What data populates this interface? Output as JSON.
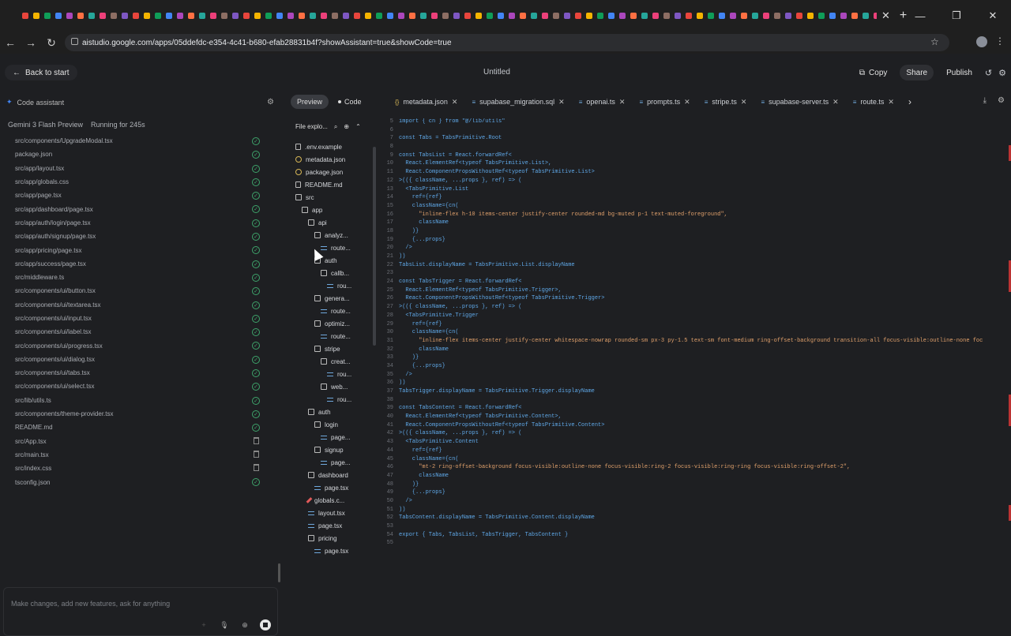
{
  "browser": {
    "tab_close": "✕",
    "new_tab": "+",
    "url": "aistudio.google.com/apps/05ddefdc-e354-4c41-b680-efab28831b4f?showAssistant=true&showCode=true",
    "win_min": "—",
    "win_max": "❐",
    "win_close": "✕"
  },
  "app": {
    "back_label": "Back to start",
    "title": "Untitled",
    "copy_label": "Copy",
    "share_label": "Share",
    "publish_label": "Publish"
  },
  "assistant": {
    "header": "Code assistant",
    "model": "Gemini 3 Flash Preview",
    "running": "Running for 245s",
    "prompt_placeholder": "Make changes, add new features, ask for anything",
    "files": [
      {
        "name": "src/components/UpgradeModal.tsx",
        "state": "done"
      },
      {
        "name": "package.json",
        "state": "done"
      },
      {
        "name": "src/app/layout.tsx",
        "state": "done"
      },
      {
        "name": "src/app/globals.css",
        "state": "done"
      },
      {
        "name": "src/app/page.tsx",
        "state": "done"
      },
      {
        "name": "src/app/dashboard/page.tsx",
        "state": "done"
      },
      {
        "name": "src/app/auth/login/page.tsx",
        "state": "done"
      },
      {
        "name": "src/app/auth/signup/page.tsx",
        "state": "done"
      },
      {
        "name": "src/app/pricing/page.tsx",
        "state": "done"
      },
      {
        "name": "src/app/success/page.tsx",
        "state": "done"
      },
      {
        "name": "src/middleware.ts",
        "state": "done"
      },
      {
        "name": "src/components/ui/button.tsx",
        "state": "done"
      },
      {
        "name": "src/components/ui/textarea.tsx",
        "state": "done"
      },
      {
        "name": "src/components/ui/input.tsx",
        "state": "done"
      },
      {
        "name": "src/components/ui/label.tsx",
        "state": "done"
      },
      {
        "name": "src/components/ui/progress.tsx",
        "state": "done"
      },
      {
        "name": "src/components/ui/dialog.tsx",
        "state": "done"
      },
      {
        "name": "src/components/ui/tabs.tsx",
        "state": "done"
      },
      {
        "name": "src/components/ui/select.tsx",
        "state": "done"
      },
      {
        "name": "src/lib/utils.ts",
        "state": "done"
      },
      {
        "name": "src/components/theme-provider.tsx",
        "state": "done"
      },
      {
        "name": "README.md",
        "state": "done"
      },
      {
        "name": "src/App.tsx",
        "state": "deleted"
      },
      {
        "name": "src/main.tsx",
        "state": "deleted"
      },
      {
        "name": "src/index.css",
        "state": "deleted"
      },
      {
        "name": "tsconfig.json",
        "state": "done"
      }
    ]
  },
  "editor": {
    "preview_label": "Preview",
    "code_label": "Code",
    "file_tabs": [
      "metadata.json",
      "supabase_migration.sql",
      "openai.ts",
      "prompts.ts",
      "stripe.ts",
      "supabase-server.ts",
      "route.ts"
    ],
    "explorer_title": "File explo...",
    "tree": [
      {
        "label": ".env.example",
        "icon": "file",
        "indent": 0
      },
      {
        "label": "metadata.json",
        "icon": "json",
        "indent": 0
      },
      {
        "label": "package.json",
        "icon": "json",
        "indent": 0
      },
      {
        "label": "README.md",
        "icon": "file",
        "indent": 0
      },
      {
        "label": "src",
        "icon": "folder",
        "indent": 0
      },
      {
        "label": "app",
        "icon": "folder",
        "indent": 1
      },
      {
        "label": "api",
        "icon": "folder",
        "indent": 2
      },
      {
        "label": "analyz...",
        "icon": "folder",
        "indent": 3
      },
      {
        "label": "route...",
        "icon": "lines",
        "indent": 4
      },
      {
        "label": "auth",
        "icon": "folder",
        "indent": 3
      },
      {
        "label": "callb...",
        "icon": "folder",
        "indent": 4
      },
      {
        "label": "rou...",
        "icon": "lines",
        "indent": 5
      },
      {
        "label": "genera...",
        "icon": "folder",
        "indent": 3
      },
      {
        "label": "route...",
        "icon": "lines",
        "indent": 4
      },
      {
        "label": "optimiz...",
        "icon": "folder",
        "indent": 3
      },
      {
        "label": "route...",
        "icon": "lines",
        "indent": 4
      },
      {
        "label": "stripe",
        "icon": "folder",
        "indent": 3
      },
      {
        "label": "creat...",
        "icon": "folder",
        "indent": 4
      },
      {
        "label": "rou...",
        "icon": "lines",
        "indent": 5
      },
      {
        "label": "web...",
        "icon": "folder",
        "indent": 4
      },
      {
        "label": "rou...",
        "icon": "lines",
        "indent": 5
      },
      {
        "label": "auth",
        "icon": "folder",
        "indent": 2
      },
      {
        "label": "login",
        "icon": "folder",
        "indent": 3
      },
      {
        "label": "page...",
        "icon": "lines",
        "indent": 4
      },
      {
        "label": "signup",
        "icon": "folder",
        "indent": 3
      },
      {
        "label": "page...",
        "icon": "lines",
        "indent": 4
      },
      {
        "label": "dashboard",
        "icon": "folder",
        "indent": 2
      },
      {
        "label": "page.tsx",
        "icon": "lines",
        "indent": 3
      },
      {
        "label": "globals.c...",
        "icon": "pen",
        "indent": 2
      },
      {
        "label": "layout.tsx",
        "icon": "lines",
        "indent": 2
      },
      {
        "label": "page.tsx",
        "icon": "lines",
        "indent": 2
      },
      {
        "label": "pricing",
        "icon": "folder",
        "indent": 2
      },
      {
        "label": "page.tsx",
        "icon": "lines",
        "indent": 3
      }
    ],
    "code_lines": [
      {
        "n": "5",
        "t": "import { cn } from \"@/lib/utils\""
      },
      {
        "n": "6",
        "t": ""
      },
      {
        "n": "7",
        "t": "const Tabs = TabsPrimitive.Root"
      },
      {
        "n": "8",
        "t": ""
      },
      {
        "n": "9",
        "t": "const TabsList = React.forwardRef<"
      },
      {
        "n": "10",
        "t": "  React.ElementRef<typeof TabsPrimitive.List>,"
      },
      {
        "n": "11",
        "t": "  React.ComponentPropsWithoutRef<typeof TabsPrimitive.List>"
      },
      {
        "n": "12",
        "t": ">(({ className, ...props }, ref) => ("
      },
      {
        "n": "13",
        "t": "  <TabsPrimitive.List"
      },
      {
        "n": "14",
        "t": "    ref={ref}"
      },
      {
        "n": "15",
        "t": "    className={cn("
      },
      {
        "n": "16",
        "t": "      \"inline-flex h-10 items-center justify-center rounded-md bg-muted p-1 text-muted-foreground\","
      },
      {
        "n": "17",
        "t": "      className"
      },
      {
        "n": "18",
        "t": "    )}"
      },
      {
        "n": "19",
        "t": "    {...props}"
      },
      {
        "n": "20",
        "t": "  />"
      },
      {
        "n": "21",
        "t": "))"
      },
      {
        "n": "22",
        "t": "TabsList.displayName = TabsPrimitive.List.displayName"
      },
      {
        "n": "23",
        "t": ""
      },
      {
        "n": "24",
        "t": "const TabsTrigger = React.forwardRef<"
      },
      {
        "n": "25",
        "t": "  React.ElementRef<typeof TabsPrimitive.Trigger>,"
      },
      {
        "n": "26",
        "t": "  React.ComponentPropsWithoutRef<typeof TabsPrimitive.Trigger>"
      },
      {
        "n": "27",
        "t": ">(({ className, ...props }, ref) => ("
      },
      {
        "n": "28",
        "t": "  <TabsPrimitive.Trigger"
      },
      {
        "n": "29",
        "t": "    ref={ref}"
      },
      {
        "n": "30",
        "t": "    className={cn("
      },
      {
        "n": "31",
        "t": "      \"inline-flex items-center justify-center whitespace-nowrap rounded-sm px-3 py-1.5 text-sm font-medium ring-offset-background transition-all focus-visible:outline-none foc"
      },
      {
        "n": "32",
        "t": "      className"
      },
      {
        "n": "33",
        "t": "    )}"
      },
      {
        "n": "34",
        "t": "    {...props}"
      },
      {
        "n": "35",
        "t": "  />"
      },
      {
        "n": "36",
        "t": "))"
      },
      {
        "n": "37",
        "t": "TabsTrigger.displayName = TabsPrimitive.Trigger.displayName"
      },
      {
        "n": "38",
        "t": ""
      },
      {
        "n": "39",
        "t": "const TabsContent = React.forwardRef<"
      },
      {
        "n": "40",
        "t": "  React.ElementRef<typeof TabsPrimitive.Content>,"
      },
      {
        "n": "41",
        "t": "  React.ComponentPropsWithoutRef<typeof TabsPrimitive.Content>"
      },
      {
        "n": "42",
        "t": ">(({ className, ...props }, ref) => ("
      },
      {
        "n": "43",
        "t": "  <TabsPrimitive.Content"
      },
      {
        "n": "44",
        "t": "    ref={ref}"
      },
      {
        "n": "45",
        "t": "    className={cn("
      },
      {
        "n": "46",
        "t": "      \"mt-2 ring-offset-background focus-visible:outline-none focus-visible:ring-2 focus-visible:ring-ring focus-visible:ring-offset-2\","
      },
      {
        "n": "47",
        "t": "      className"
      },
      {
        "n": "48",
        "t": "    )}"
      },
      {
        "n": "49",
        "t": "    {...props}"
      },
      {
        "n": "50",
        "t": "  />"
      },
      {
        "n": "51",
        "t": "))"
      },
      {
        "n": "52",
        "t": "TabsContent.displayName = TabsPrimitive.Content.displayName"
      },
      {
        "n": "53",
        "t": ""
      },
      {
        "n": "54",
        "t": "export { Tabs, TabsList, TabsTrigger, TabsContent }"
      },
      {
        "n": "55",
        "t": ""
      }
    ]
  },
  "colors": {
    "ok": "#3ea46b",
    "code": "#5fa8e8",
    "accent": "#4285f4"
  }
}
